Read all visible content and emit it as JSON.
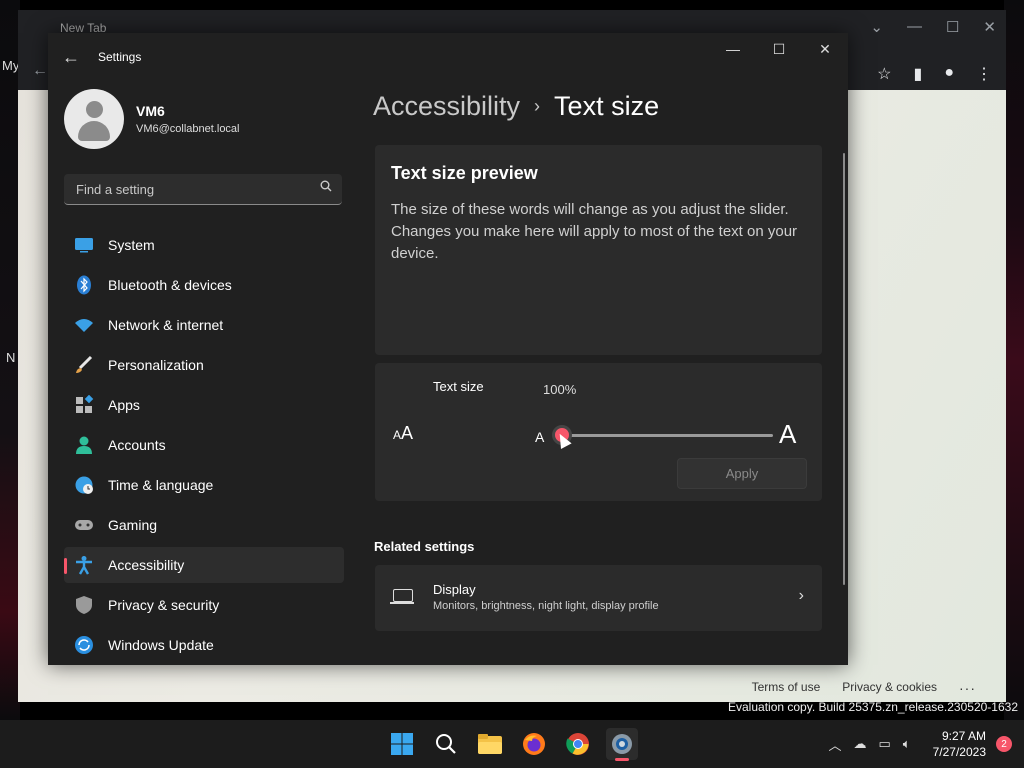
{
  "desktop": {
    "left_chars": [
      "My",
      "N"
    ]
  },
  "browser": {
    "tab_title": "New Tab",
    "footer_links": [
      "Terms of use",
      "Privacy & cookies"
    ],
    "more": "···"
  },
  "settings": {
    "app_title": "Settings",
    "user": {
      "name": "VM6",
      "email": "VM6@collabnet.local"
    },
    "search": {
      "placeholder": "Find a setting"
    },
    "nav": [
      {
        "label": "System",
        "icon": "system-icon"
      },
      {
        "label": "Bluetooth & devices",
        "icon": "bluetooth-icon"
      },
      {
        "label": "Network & internet",
        "icon": "wifi-icon"
      },
      {
        "label": "Personalization",
        "icon": "brush-icon"
      },
      {
        "label": "Apps",
        "icon": "apps-icon"
      },
      {
        "label": "Accounts",
        "icon": "accounts-icon"
      },
      {
        "label": "Time & language",
        "icon": "globe-icon"
      },
      {
        "label": "Gaming",
        "icon": "gamepad-icon"
      },
      {
        "label": "Accessibility",
        "icon": "accessibility-icon",
        "active": true
      },
      {
        "label": "Privacy & security",
        "icon": "shield-icon"
      },
      {
        "label": "Windows Update",
        "icon": "update-icon"
      }
    ],
    "breadcrumb": {
      "parent": "Accessibility",
      "separator": "›",
      "current": "Text size"
    },
    "preview": {
      "title": "Text size preview",
      "body": "The size of these words will change as you adjust the slider. Changes you make here will apply to most of the text on your device."
    },
    "text_size": {
      "label": "Text size",
      "value": "100%",
      "slider_fraction": 0.0,
      "small_glyph": "A",
      "large_glyph": "A",
      "apply_label": "Apply"
    },
    "related": {
      "heading": "Related settings",
      "display": {
        "title": "Display",
        "subtitle": "Monitors, brightness, night light, display profile"
      }
    },
    "accent_color": "#f7566a"
  },
  "taskbar": {
    "apps": [
      "windows-start-icon",
      "search-icon",
      "file-explorer-icon",
      "firefox-icon",
      "chrome-icon",
      "settings-icon"
    ],
    "time": "9:27 AM",
    "date": "7/27/2023",
    "notification_count": "2"
  },
  "watermark": "Evaluation copy. Build 25375.zn_release.230520-1632"
}
